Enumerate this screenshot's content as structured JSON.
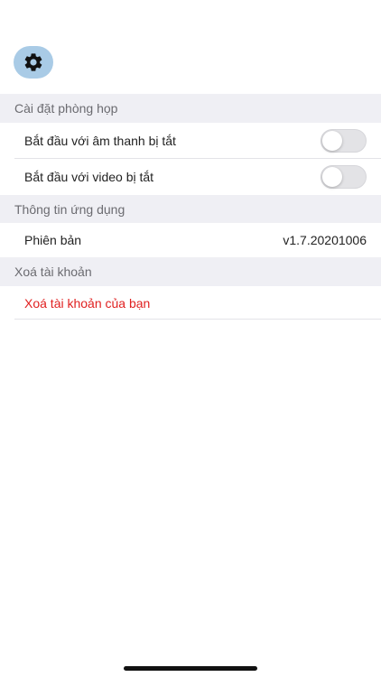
{
  "header": {
    "settings_icon": "gear-icon"
  },
  "sections": {
    "meeting": {
      "title": "Cài đặt phòng họp",
      "audio_off_label": "Bắt đầu với âm thanh bị tắt",
      "audio_off_enabled": false,
      "video_off_label": "Bắt đầu với video bị tắt",
      "video_off_enabled": false
    },
    "app_info": {
      "title": "Thông tin ứng dụng",
      "version_label": "Phiên bản",
      "version_value": "v1.7.20201006"
    },
    "delete_account": {
      "title": "Xoá tài khoản",
      "action_label": "Xoá tài khoản của bạn"
    }
  },
  "colors": {
    "gear_button_bg": "#a9cbe6",
    "danger": "#e02020",
    "section_header_bg": "#efeff4"
  }
}
